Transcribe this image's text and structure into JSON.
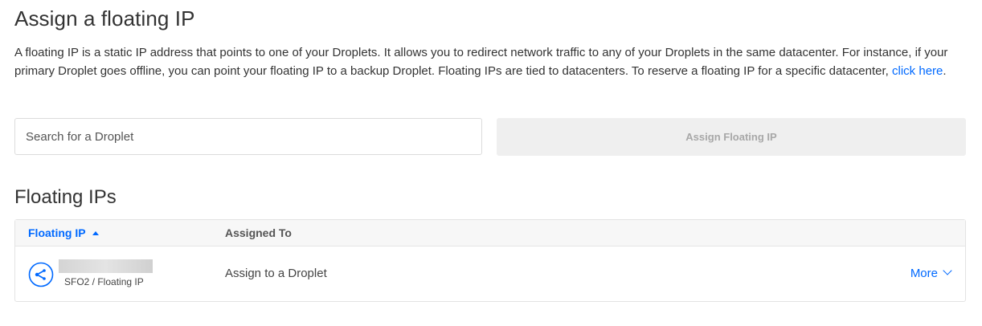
{
  "assign": {
    "title": "Assign a floating IP",
    "description": "A floating IP is a static IP address that points to one of your Droplets. It allows you to redirect network traffic to any of your Droplets in the same datacenter. For instance, if your primary Droplet goes offline, you can point your floating IP to a backup Droplet. Floating IPs are tied to datacenters. To reserve a floating IP for a specific datacenter,",
    "link_text": "click here",
    "link_suffix": ".",
    "search_placeholder": "Search for a Droplet",
    "button_label": "Assign Floating IP"
  },
  "floating_ips": {
    "title": "Floating IPs",
    "columns": [
      "Floating IP",
      "Assigned To"
    ],
    "rows": [
      {
        "ip": "",
        "region": "SFO2 / Floating IP",
        "assigned_to": "Assign to a Droplet",
        "action": "More",
        "icon": "floating-ip-icon"
      }
    ]
  },
  "colors": {
    "accent": "#0069ff",
    "text": "#333333",
    "disabled_bg": "#efefef",
    "disabled_text": "#a8a8a8"
  }
}
